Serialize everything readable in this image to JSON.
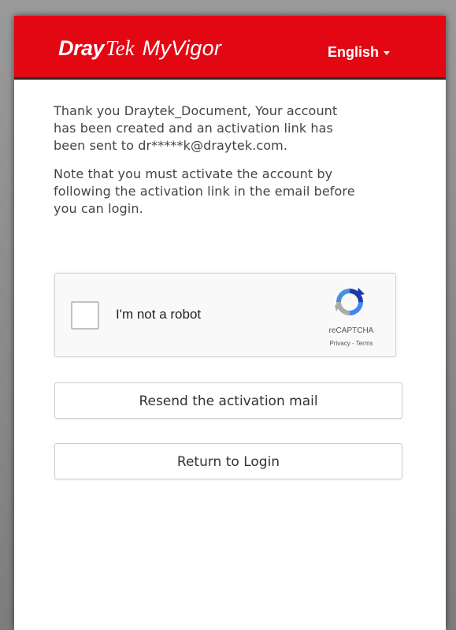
{
  "header": {
    "logo_dray": "Dray",
    "logo_tek": "Tek",
    "logo_product": "MyVigor",
    "language_label": "English",
    "background_color": "#e30613"
  },
  "message": {
    "paragraph1_lines": [
      "Thank you Draytek_Document, Your account",
      "has been created and an activation link has",
      "been sent to dr*****k@draytek.com."
    ],
    "paragraph2_lines": [
      "Note that you must activate the account by",
      "following the activation link in the email before",
      "you can login."
    ]
  },
  "captcha": {
    "checkbox_label": "I'm not a robot",
    "brand": "reCAPTCHA",
    "privacy_link": "Privacy",
    "separator": "-",
    "terms_link": "Terms",
    "icon": "recaptcha-logo-icon"
  },
  "actions": {
    "resend_label": "Resend the activation mail",
    "return_label": "Return to Login"
  }
}
